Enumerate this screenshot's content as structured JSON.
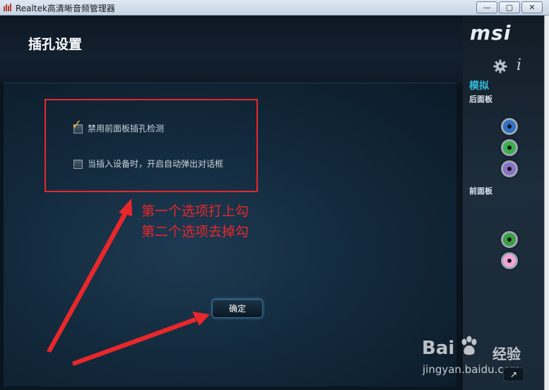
{
  "window": {
    "title": "Realtek高清晰音频管理器",
    "minimize_label": "—",
    "maximize_label": "▢",
    "close_label": "✕"
  },
  "header": {
    "title": "插孔设置"
  },
  "brand": {
    "logo_text": "msi"
  },
  "sidebar": {
    "settings_icon": "gear-icon",
    "info_label": "i",
    "analog_label": "模拟",
    "rear_panel_label": "后面板",
    "front_panel_label": "前面板",
    "rear_jacks": [
      {
        "color": "#2f6fc7",
        "name": "blue"
      },
      {
        "color": "#3bb04a",
        "name": "green"
      },
      {
        "color": "#8a70c9",
        "name": "purple"
      }
    ],
    "front_jacks": [
      {
        "color": "#3a9e43",
        "name": "green"
      },
      {
        "color": "#f3a7d9",
        "name": "pink"
      }
    ]
  },
  "options": [
    {
      "label": "禁用前面板插孔检测",
      "checked": true
    },
    {
      "label": "当插入设备时，开启自动弹出对话框",
      "checked": false
    }
  ],
  "annotations": {
    "line1": "第一个选项打上勾",
    "line2": "第二个选项去掉勾",
    "color": "#e8272a"
  },
  "ok_button": {
    "label": "确定"
  },
  "watermark": {
    "logo_text": "Bai",
    "brand_suffix": "经验",
    "url": "jingyan.baidu.com"
  },
  "next_button": {
    "label": "↗"
  }
}
